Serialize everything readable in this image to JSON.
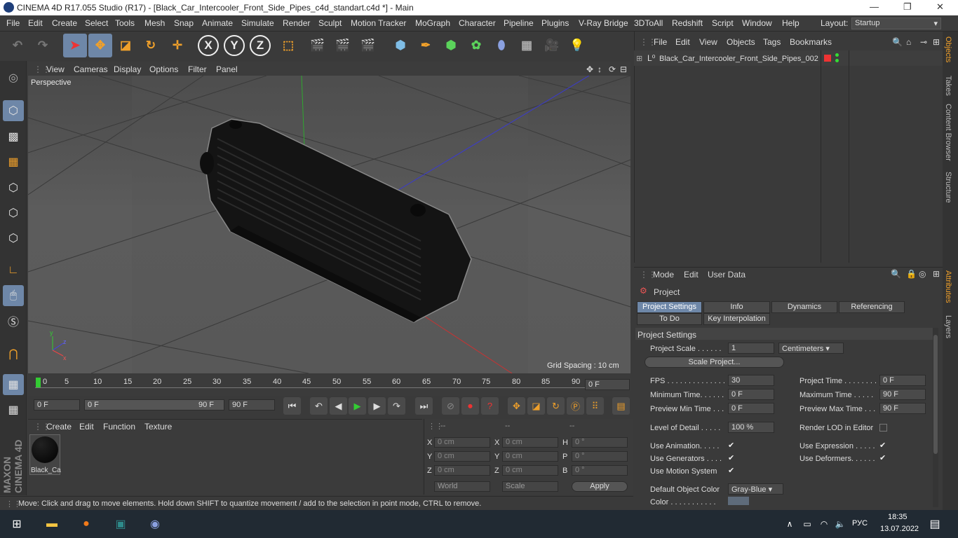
{
  "window": {
    "title": "CINEMA 4D R17.055 Studio (R17) - [Black_Car_Intercooler_Front_Side_Pipes_c4d_standart.c4d *] - Main",
    "min": "—",
    "restore": "❐",
    "close": "✕"
  },
  "menubar": {
    "items": [
      "File",
      "Edit",
      "Create",
      "Select",
      "Tools",
      "Mesh",
      "Snap",
      "Animate",
      "Simulate",
      "Render",
      "Sculpt",
      "Motion Tracker",
      "MoGraph",
      "Character",
      "Pipeline",
      "Plugins",
      "V-Ray Bridge",
      "3DToAll",
      "Redshift",
      "Script",
      "Window",
      "Help"
    ],
    "layout_label": "Layout:",
    "layout_value": "Startup"
  },
  "toolbar": {
    "x": "X",
    "y": "Y",
    "z": "Z"
  },
  "viewport": {
    "menu": [
      "View",
      "Cameras",
      "Display",
      "Options",
      "Filter",
      "Panel"
    ],
    "label": "Perspective",
    "grid_spacing": "Grid Spacing : 10 cm"
  },
  "timeline": {
    "ticks": [
      "0",
      "5",
      "10",
      "15",
      "20",
      "25",
      "30",
      "35",
      "40",
      "45",
      "50",
      "55",
      "60",
      "65",
      "70",
      "75",
      "80",
      "85",
      "90"
    ],
    "current": "0 F",
    "field_start": "0 F",
    "range_start": "0 F",
    "range_end": "90 F",
    "field_end": "90 F"
  },
  "materials": {
    "menu": [
      "Create",
      "Edit",
      "Function",
      "Texture"
    ],
    "item_label": "Black_Ca"
  },
  "coordinates": {
    "headers": [
      "--",
      "--",
      "--"
    ],
    "rows": [
      {
        "a": "X",
        "av": "0 cm",
        "b": "X",
        "bv": "0 cm",
        "c": "H",
        "cv": "0 °"
      },
      {
        "a": "Y",
        "av": "0 cm",
        "b": "Y",
        "bv": "0 cm",
        "c": "P",
        "cv": "0 °"
      },
      {
        "a": "Z",
        "av": "0 cm",
        "b": "Z",
        "bv": "0 cm",
        "c": "B",
        "cv": "0 °"
      }
    ],
    "mode1": "World",
    "mode2": "Scale",
    "apply": "Apply"
  },
  "statusbar": {
    "text": "Move: Click and drag to move elements. Hold down SHIFT to quantize movement / add to the selection in point mode, CTRL to remove."
  },
  "objects": {
    "menu": [
      "File",
      "Edit",
      "View",
      "Objects",
      "Tags",
      "Bookmarks"
    ],
    "item": "Black_Car_Intercooler_Front_Side_Pipes_002"
  },
  "right_tabs": [
    "Objects",
    "Takes",
    "Content Browser",
    "Structure",
    "Attributes",
    "Layers"
  ],
  "attributes": {
    "menu": [
      "Mode",
      "Edit",
      "User Data"
    ],
    "title": "Project",
    "tabs": [
      "Project Settings",
      "Info",
      "Dynamics",
      "Referencing",
      "To Do",
      "Key Interpolation"
    ],
    "section": "Project Settings",
    "project_scale_label": "Project Scale . . . . . .",
    "project_scale_value": "1",
    "project_scale_unit": "Centimeters",
    "scale_project_button": "Scale Project...",
    "fps_label": "FPS . . . . . . . . . . . . . . .",
    "fps_value": "30",
    "project_time_label": "Project Time . . . . . . . .",
    "project_time_value": "0 F",
    "min_time_label": "Minimum Time. . . . . .",
    "min_time_value": "0 F",
    "max_time_label": "Maximum Time . . . . .",
    "max_time_value": "90 F",
    "prev_min_label": "Preview Min Time . . .",
    "prev_min_value": "0 F",
    "prev_max_label": "Preview Max Time . . .",
    "prev_max_value": "90 F",
    "lod_label": "Level of Detail . . . . .",
    "lod_value": "100 %",
    "render_lod_label": "Render LOD in Editor",
    "use_anim_label": "Use Animation. . . . .",
    "use_expr_label": "Use Expression . . . . .",
    "use_gen_label": "Use Generators . . . .",
    "use_def_label": "Use Deformers. . . . . .",
    "use_motion_label": "Use Motion System",
    "def_color_label": "Default Object Color",
    "def_color_value": "Gray-Blue",
    "color_label": "Color . . . . . . . . . . .",
    "check": "✔"
  },
  "taskbar": {
    "lang": "РУС",
    "time": "18:35",
    "date": "13.07.2022"
  },
  "colors": {
    "accent": "#6e87a8",
    "icon_orange": "#f0a02a",
    "taskbar": "#212a33"
  }
}
